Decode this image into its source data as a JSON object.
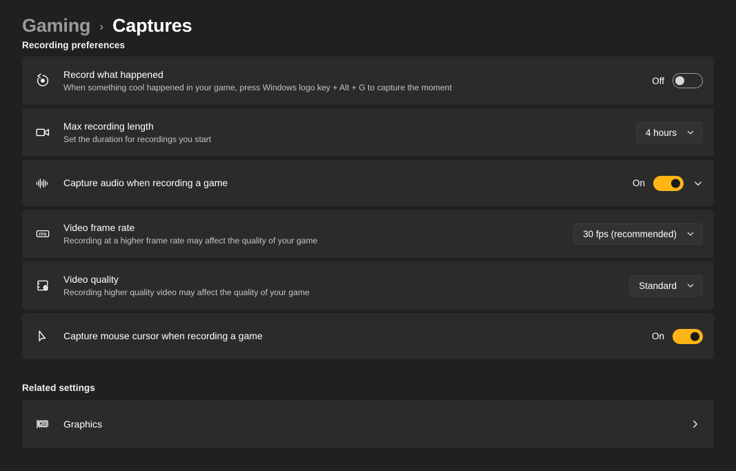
{
  "breadcrumb": {
    "parent": "Gaming",
    "separator": "›",
    "current": "Captures"
  },
  "sections": {
    "recording_heading": "Recording preferences",
    "related_heading": "Related settings"
  },
  "accent_color": "#ffb515",
  "card_color": "#2b2b2b",
  "page_background": "#202020",
  "rows": {
    "record_what_happened": {
      "icon": "instant-replay-icon",
      "title": "Record what happened",
      "description": "When something cool happened in your game, press Windows logo key + Alt + G to capture the moment",
      "toggle_state": "Off"
    },
    "max_recording_length": {
      "icon": "video-camera-icon",
      "title": "Max recording length",
      "description": "Set the duration for recordings you start",
      "dropdown_value": "4 hours"
    },
    "capture_audio": {
      "icon": "audio-waveform-icon",
      "title": "Capture audio when recording a game",
      "toggle_state": "On",
      "expand_icon": "chevron-down-icon"
    },
    "video_frame_rate": {
      "icon": "fps-icon",
      "icon_text": "FPS",
      "title": "Video frame rate",
      "description": "Recording at a higher frame rate may affect the quality of your game",
      "dropdown_value": "30 fps (recommended)"
    },
    "video_quality": {
      "icon": "video-settings-icon",
      "title": "Video quality",
      "description": "Recording higher quality video may affect the quality of your game",
      "dropdown_value": "Standard"
    },
    "capture_mouse_cursor": {
      "icon": "mouse-pointer-icon",
      "title": "Capture mouse cursor when recording a game",
      "toggle_state": "On"
    },
    "graphics": {
      "icon": "graphics-card-icon",
      "title": "Graphics",
      "nav_icon": "chevron-right-icon"
    }
  }
}
